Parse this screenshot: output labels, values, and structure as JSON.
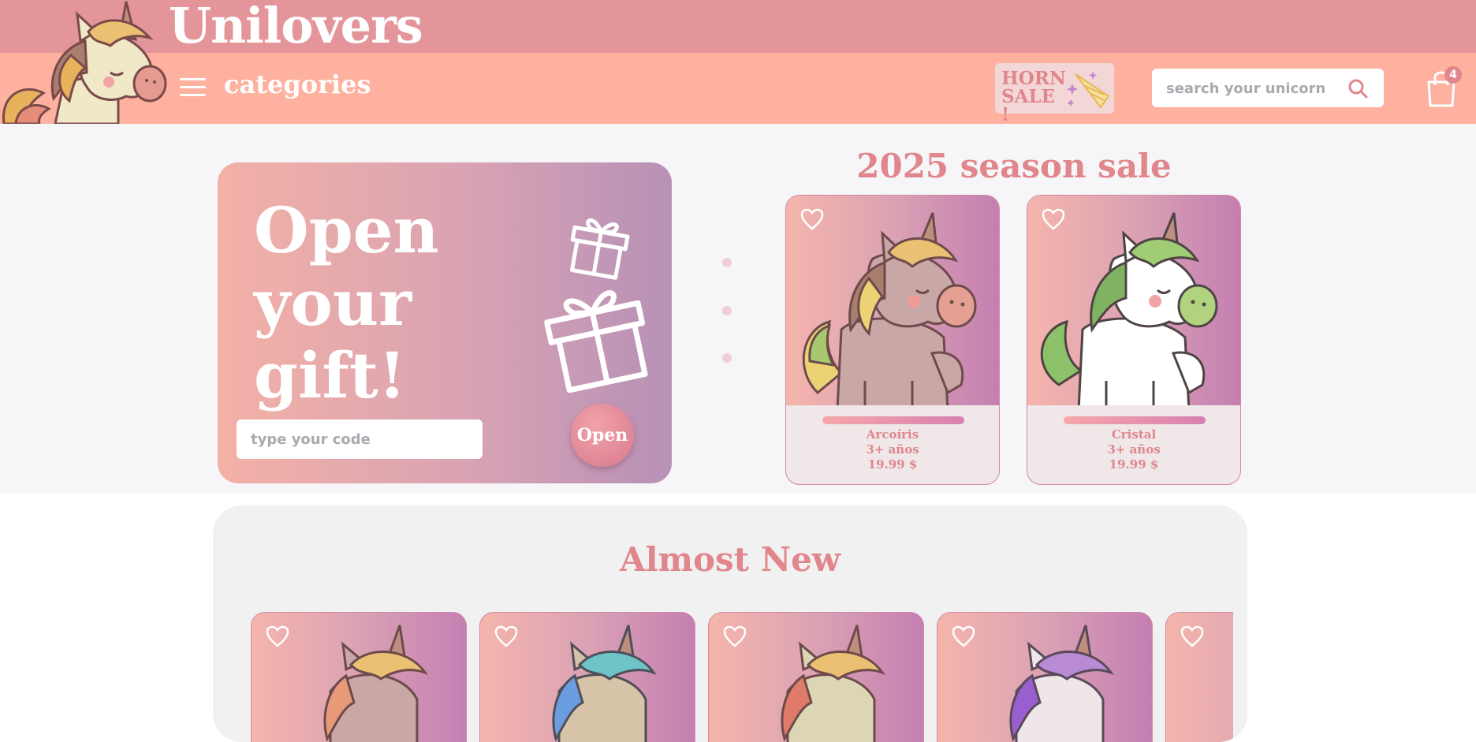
{
  "header": {
    "brand": "Unilovers",
    "categories_label": "categories",
    "horn_sale": "HORN SALE !",
    "search": {
      "placeholder": "search your unicorn"
    },
    "cart_count": "4"
  },
  "gift": {
    "title": "Open your gift!",
    "code_placeholder": "type your code",
    "open_label": "Open"
  },
  "season": {
    "title": "2025 season sale",
    "products": [
      {
        "name": "Arcoíris",
        "age": "3+ años",
        "price": "19.99 $",
        "mane": "rainbow",
        "body_color": "#c9a7a7"
      },
      {
        "name": "Cristal",
        "age": "3+ años",
        "price": "19.99 $",
        "mane": "green",
        "body_color": "#ffffff"
      }
    ]
  },
  "almost_new": {
    "title": "Almost New",
    "items": [
      {
        "mane": "rainbow"
      },
      {
        "mane": "blue"
      },
      {
        "mane": "rainbow"
      },
      {
        "mane": "purple"
      },
      {
        "mane": "partial"
      }
    ]
  },
  "colors": {
    "top_band": "#e39599",
    "nav_band": "#fdb19e",
    "accent": "#e0868c"
  }
}
